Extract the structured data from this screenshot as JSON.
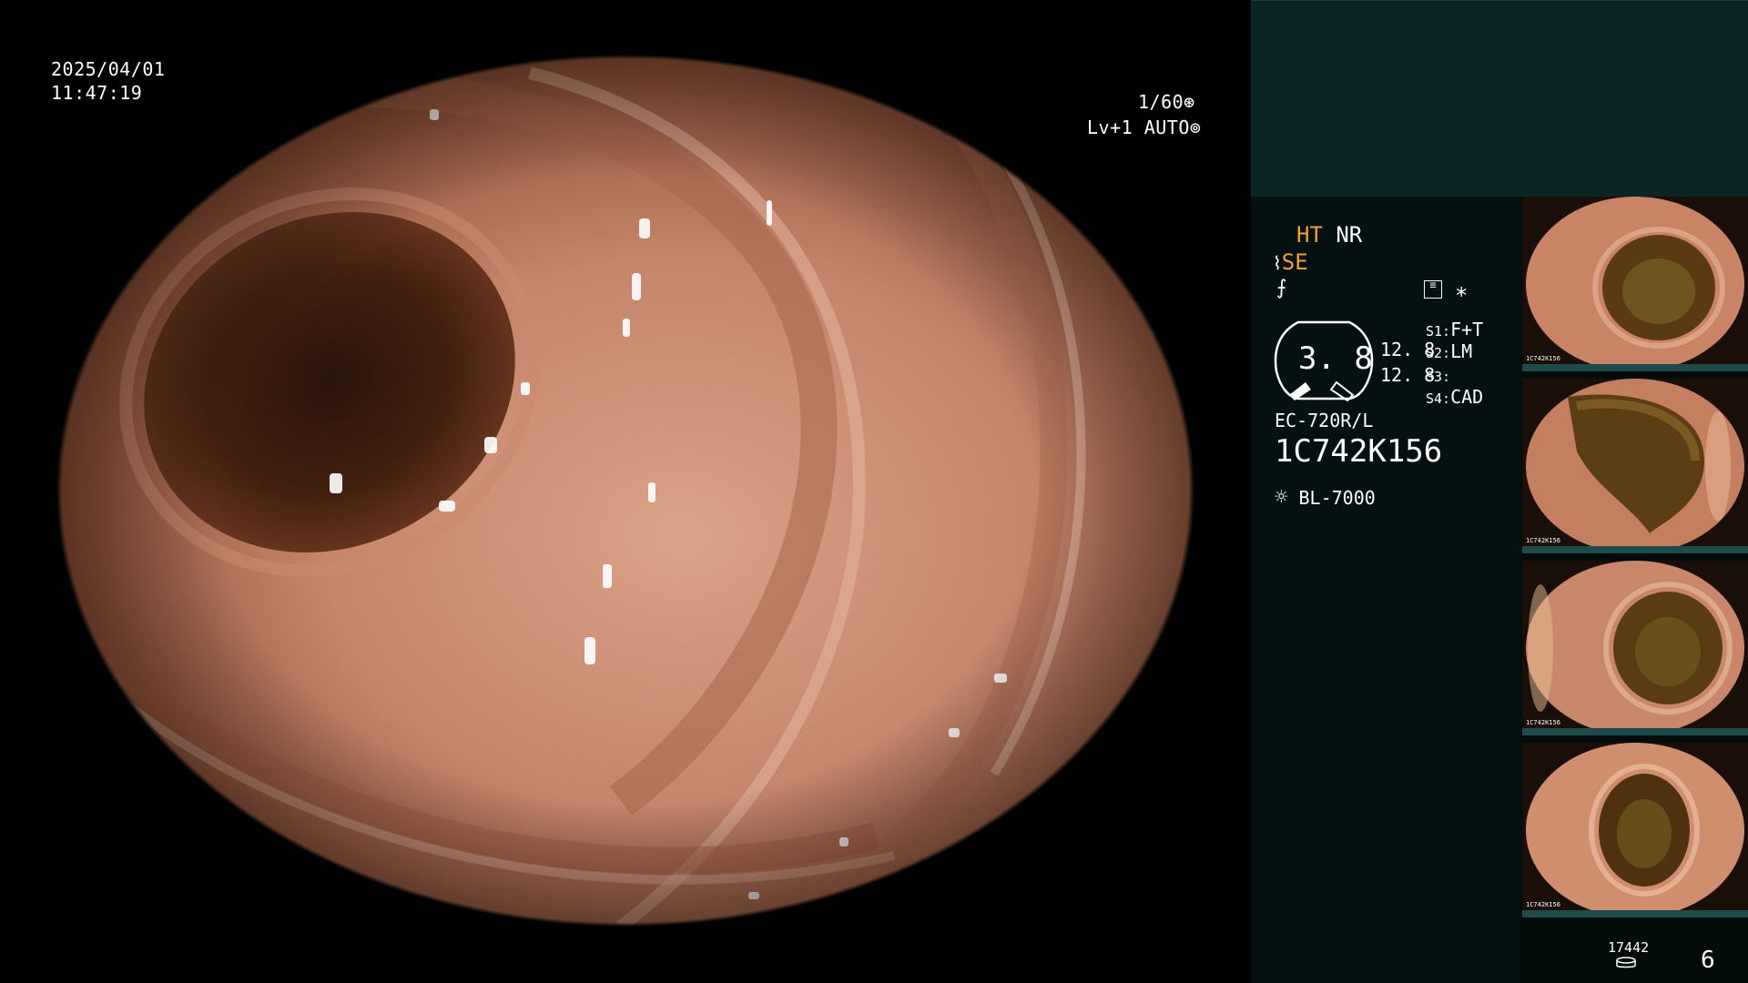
{
  "overlay": {
    "date": "2025/04/01",
    "time": "11:47:19",
    "shutter": "1/60",
    "level_mode": "Lv+1 AUTO"
  },
  "modes": {
    "ht": "HT",
    "nr": "NR",
    "se": "SE"
  },
  "zoom_value": "3. 8",
  "gain_1": "12. 8",
  "gain_2": "12. 8",
  "switches": [
    {
      "key": "S1:",
      "value": "F+T"
    },
    {
      "key": "S2:",
      "value": "LM"
    },
    {
      "key": "S3:",
      "value": ""
    },
    {
      "key": "S4:",
      "value": "CAD"
    }
  ],
  "scope": {
    "model": "EC-720R/L",
    "serial": "1C742K156"
  },
  "light_source": "BL-7000",
  "storage": {
    "count": "17442",
    "index": "6"
  },
  "colors": {
    "accent": "#f0a030",
    "panel_top": "#0b2525",
    "panel_info": "#051111",
    "thumb_bar": "#1f4a4a"
  },
  "icons": [
    "shutter-icon",
    "auto-iris-icon",
    "structure-enhance-icon",
    "color-enhance-icon",
    "settings-list-icon",
    "asterisk-icon",
    "zoom-gauge-icon",
    "light-source-icon",
    "storage-icon"
  ],
  "thumbnails": [
    {
      "label": "1C742K156"
    },
    {
      "label": "1C742K156"
    },
    {
      "label": "1C742K156"
    },
    {
      "label": "1C742K156"
    }
  ]
}
